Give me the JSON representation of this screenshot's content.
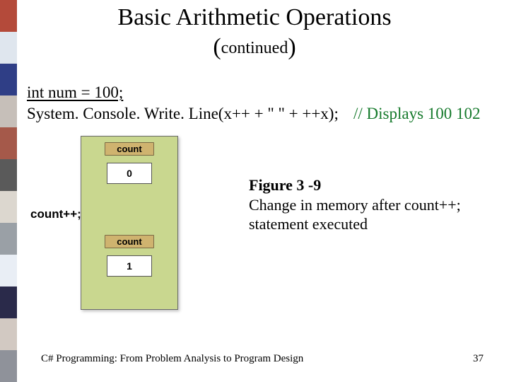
{
  "title": "Basic Arithmetic Operations",
  "subtitle_inner": "continued",
  "code": {
    "decl": "int num = 100;",
    "stmt": "System. Console. Write. Line(x++ + \" \" +  ++x);",
    "comment": "// Displays 100 102"
  },
  "diagram": {
    "label_top": "count",
    "value_top": "0",
    "statement": "count++;",
    "label_bottom": "count",
    "value_bottom": "1"
  },
  "caption": {
    "figure": "Figure 3 -9",
    "text": "Change in memory after count++; statement executed"
  },
  "footer": {
    "left": "C# Programming: From Problem Analysis to Program Design",
    "page": "37"
  },
  "sidebar_colors": [
    "#b44a3a",
    "#dfe6ee",
    "#2f3e86",
    "#c6bfb9",
    "#a5594a",
    "#5a5a5a",
    "#dcd7cf",
    "#9aa0a6",
    "#e9eef5",
    "#2a2a4a",
    "#d2c9c2",
    "#8f929a"
  ]
}
